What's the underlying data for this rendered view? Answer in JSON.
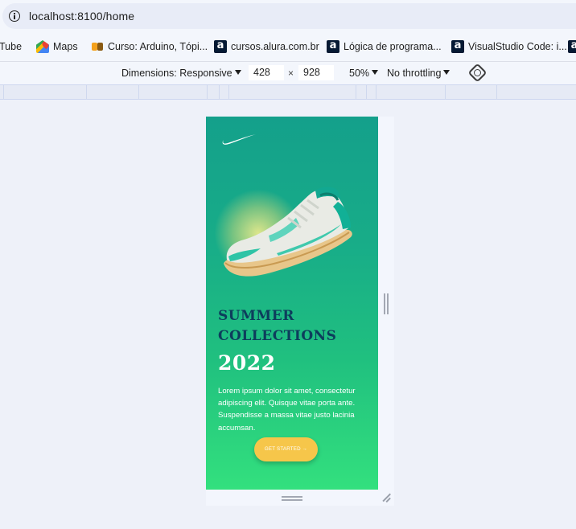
{
  "browser": {
    "url": "localhost:8100/home"
  },
  "bookmarks": [
    {
      "label": "Tube",
      "icon": "youtube-icon"
    },
    {
      "label": "Maps",
      "icon": "google-maps-icon"
    },
    {
      "label": "Curso: Arduino, Tópi...",
      "icon": "arduino-icon"
    },
    {
      "label": "cursos.alura.com.br",
      "icon": "alura-icon"
    },
    {
      "label": "Lógica de programa...",
      "icon": "alura-icon"
    },
    {
      "label": "VisualStudio Code: i...",
      "icon": "alura-icon"
    }
  ],
  "devtools": {
    "dimensions_label": "Dimensions: Responsive",
    "width": "428",
    "height": "928",
    "times": "×",
    "zoom": "50%",
    "throttling": "No throttling"
  },
  "page": {
    "headline_line1": "SUMMER",
    "headline_line2": "COLLECTIONS",
    "year": "2022",
    "description": "Lorem ipsum dolor sit amet, consectetur adipiscing elit. Quisque vitae porta ante. Suspendisse a massa vitae justo lacinia accumsan.",
    "cta_label": "GET STARTED →",
    "colors": {
      "gradient_top": "#14a08b",
      "gradient_bottom": "#33e07e",
      "headline": "#0d3d5c",
      "cta": "#f6c64a"
    }
  }
}
